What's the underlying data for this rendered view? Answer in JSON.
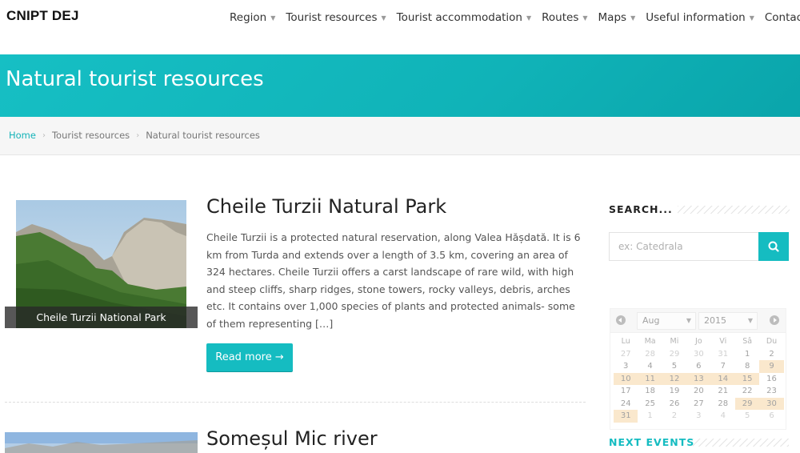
{
  "header": {
    "logo": "CNIPT DEJ",
    "nav": [
      {
        "label": "Region",
        "has_dropdown": true
      },
      {
        "label": "Tourist resources",
        "has_dropdown": true
      },
      {
        "label": "Tourist accommodation",
        "has_dropdown": true
      },
      {
        "label": "Routes",
        "has_dropdown": true
      },
      {
        "label": "Maps",
        "has_dropdown": true
      },
      {
        "label": "Useful information",
        "has_dropdown": true
      },
      {
        "label": "Contact",
        "has_dropdown": true
      }
    ]
  },
  "page_title": "Natural tourist resources",
  "breadcrumb": [
    "Home",
    "Tourist resources",
    "Natural tourist resources"
  ],
  "articles": [
    {
      "title": "Cheile Turzii Natural Park",
      "caption": "Cheile Turzii National Park",
      "text": "Cheile Turzii is a protected natural reservation, along Valea Hășdată. It is 6 km from Turda and extends over a length of 3.5 km, covering an area of 324 hectares. Cheile Turzii offers a carst landscape of rare wild, with high and steep cliffs, sharp ridges, stone towers, rocky valleys, debris, arches etc. It contains over 1,000 species of plants and protected animals- some of them representing […]",
      "read_more": "Read more →"
    },
    {
      "title": "Someșul Mic river"
    }
  ],
  "sidebar": {
    "search_heading": "SEARCH...",
    "search_placeholder": "ex: Catedrala",
    "calendar": {
      "month": "Aug",
      "year": "2015",
      "weekdays": [
        "Lu",
        "Ma",
        "Mi",
        "Jo",
        "Vi",
        "Sâ",
        "Du"
      ],
      "weeks": [
        [
          {
            "d": "27",
            "m": "o"
          },
          {
            "d": "28",
            "m": "o"
          },
          {
            "d": "29",
            "m": "o"
          },
          {
            "d": "30",
            "m": "o"
          },
          {
            "d": "31",
            "m": "o"
          },
          {
            "d": "1",
            "m": "c"
          },
          {
            "d": "2",
            "m": "c"
          }
        ],
        [
          {
            "d": "3",
            "m": "c"
          },
          {
            "d": "4",
            "m": "c"
          },
          {
            "d": "5",
            "m": "c"
          },
          {
            "d": "6",
            "m": "c"
          },
          {
            "d": "7",
            "m": "c"
          },
          {
            "d": "8",
            "m": "c"
          },
          {
            "d": "9",
            "m": "e"
          }
        ],
        [
          {
            "d": "10",
            "m": "e"
          },
          {
            "d": "11",
            "m": "e"
          },
          {
            "d": "12",
            "m": "e"
          },
          {
            "d": "13",
            "m": "e"
          },
          {
            "d": "14",
            "m": "e"
          },
          {
            "d": "15",
            "m": "e"
          },
          {
            "d": "16",
            "m": "c"
          }
        ],
        [
          {
            "d": "17",
            "m": "c"
          },
          {
            "d": "18",
            "m": "c"
          },
          {
            "d": "19",
            "m": "c"
          },
          {
            "d": "20",
            "m": "c"
          },
          {
            "d": "21",
            "m": "c"
          },
          {
            "d": "22",
            "m": "c"
          },
          {
            "d": "23",
            "m": "c"
          }
        ],
        [
          {
            "d": "24",
            "m": "c"
          },
          {
            "d": "25",
            "m": "c"
          },
          {
            "d": "26",
            "m": "c"
          },
          {
            "d": "27",
            "m": "c"
          },
          {
            "d": "28",
            "m": "c"
          },
          {
            "d": "29",
            "m": "e"
          },
          {
            "d": "30",
            "m": "e"
          }
        ],
        [
          {
            "d": "31",
            "m": "e"
          },
          {
            "d": "1",
            "m": "o"
          },
          {
            "d": "2",
            "m": "o"
          },
          {
            "d": "3",
            "m": "o"
          },
          {
            "d": "4",
            "m": "o"
          },
          {
            "d": "5",
            "m": "o"
          },
          {
            "d": "6",
            "m": "o"
          }
        ]
      ]
    },
    "events_heading": "NEXT EVENTS"
  },
  "colors": {
    "accent": "#15bcc1",
    "event_highlight": "#f6d6a6"
  }
}
